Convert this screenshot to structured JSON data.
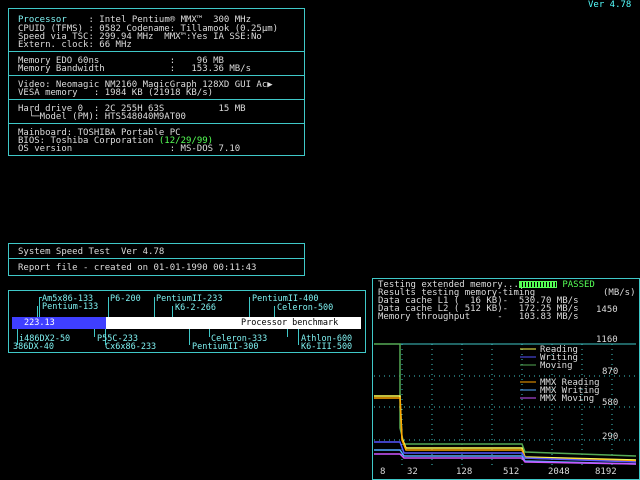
{
  "version": "Ver 4.78",
  "info": {
    "processor_label": "Processor",
    "processor_value": ": Intel Pentium® MMX™  300 MHz",
    "cpuid_line": "CPUID (TFMS) : 0582 Codename: Tillamook (0.25µm)",
    "speed_line": "Speed via TSC: 299.94 MHz  MMX™:Yes IA SSE:No",
    "clock_line": "Extern. clock: 66 MHz",
    "memory_line": "Memory EDO 60ns             :    96 MB",
    "bandwidth_line": "Memory Bandwidth            :   153.36 MB/s",
    "video_line": "Video: Neomagic NM2160 MagicGraph 128XD GUI Ac",
    "video_more": "▶",
    "vesa_line": "VESA memory   : 1984 KB (21918 KB/s)",
    "hd_line": "Hard drive 0  : 2C 255H 63S          15 MB",
    "model_line": "  └─Model (PM): HTS548040M9AT00",
    "mainboard_line": "Mainboard: TOSHIBA Portable PC",
    "bios_prefix": "BIOS: Toshiba Corporation ",
    "bios_date": "(12/29/99)",
    "os_line": "OS version                  : MS-DOS 7.10"
  },
  "speedtest": {
    "title": "System Speed Test  Ver 4.78",
    "report": "Report file - created on 01-01-1990 00:11:43"
  },
  "benchmark": {
    "score": "223.13",
    "score_fraction": 0.27,
    "label": "Processor benchmark",
    "top_labels": [
      "Am5x86-133",
      "P6-200",
      "PentiumII-233",
      "PentiumII-400",
      "Pentium-133",
      "K6-2-266",
      "Celeron-500"
    ],
    "bottom_labels": [
      "i486DX2-50",
      "P55C-233",
      "Celeron-333",
      "Athlon-600",
      "386DX-40",
      "Cx6x86-233",
      "PentiumII-300",
      "K6-III-500"
    ]
  },
  "results": {
    "testing_line": "Testing extended memory...",
    "passed": "PASSED",
    "results_title": "Results testing memory-timing",
    "units": "(MB/s)",
    "l1_line": "Data cache L1 (  16 KB)-  530.70 MB/s",
    "l2_line": "Data cache L2 ( 512 KB)-  172.25 MB/s",
    "mem_line": "Memory throughput     -   103.83 MB/s"
  },
  "graph": {
    "y_ticks": [
      "1450",
      "1160",
      "870",
      "580",
      "290"
    ],
    "x_ticks": [
      "8",
      "32",
      "128",
      "512",
      "2048",
      "8192"
    ],
    "legend": [
      "Reading",
      "Writing",
      "Moving",
      "MMX Reading",
      "MMX Writing",
      "MMX Moving"
    ],
    "legend_colors": [
      "#ffff55",
      "#5555ff",
      "#55aa55",
      "#ffa500",
      "#55aaff",
      "#cc55ff"
    ]
  }
}
